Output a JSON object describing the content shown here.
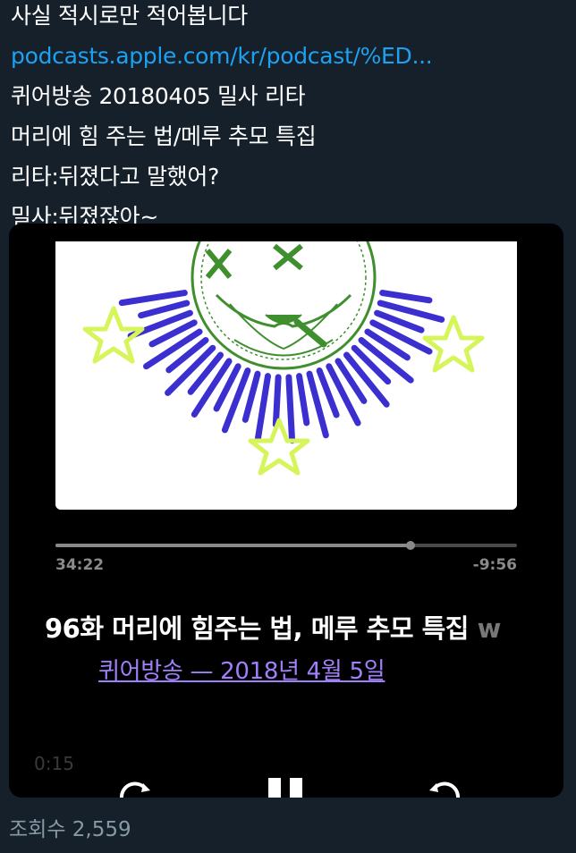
{
  "tweet": {
    "lines": [
      "사실 적시로만 적어봅니다",
      "podcasts.apple.com/kr/podcast/%ED...",
      "퀴어방송 20180405 밀사 리타",
      "머리에 힘 주는 법/메루 추모 특집",
      "리타:뒤졌다고 말했어?",
      "밀사:뒤졌잖아~"
    ],
    "link_color": "#1da1f2"
  },
  "player": {
    "elapsed": "34:22",
    "remaining": "-9:56",
    "progress_fraction": 0.77,
    "episode_title": "96화 머리에 힘주는 법, 메루 추모 특집",
    "episode_title_overflow": "w",
    "show_and_date": "퀴어방송 — 2018년 4월 5일",
    "video_time": "0:15",
    "icons": [
      "rewind-15-icon",
      "pause-icon",
      "forward-15-icon"
    ],
    "meta_color": "#a080f8"
  },
  "footer": {
    "view_count": "조회수 2,559"
  },
  "colors": {
    "background": "#15202b",
    "text": "#ffffff",
    "muted": "#8899a6"
  }
}
